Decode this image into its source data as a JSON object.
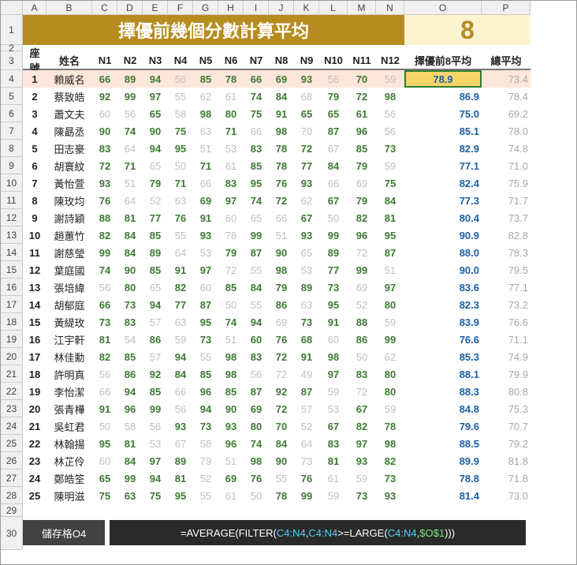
{
  "banner_title": "擇優前幾個分數計算平均",
  "banner_value": "8",
  "col_headers": [
    "A",
    "B",
    "C",
    "D",
    "E",
    "F",
    "G",
    "H",
    "I",
    "J",
    "K",
    "L",
    "M",
    "N",
    "O",
    "P"
  ],
  "row_numbers": [
    1,
    2,
    3,
    4,
    5,
    6,
    7,
    8,
    9,
    10,
    11,
    12,
    13,
    14,
    15,
    16,
    17,
    18,
    19,
    20,
    21,
    22,
    23,
    24,
    25,
    26,
    27,
    28,
    29,
    30
  ],
  "th": {
    "seat": "座號",
    "name": "姓名",
    "n": [
      "N1",
      "N2",
      "N3",
      "N4",
      "N5",
      "N6",
      "N7",
      "N8",
      "N9",
      "N10",
      "N11",
      "N12"
    ],
    "best8": "擇優前8平均",
    "avg": "總平均"
  },
  "rows": [
    {
      "seat": 1,
      "name": "賴威名",
      "s": [
        66,
        89,
        94,
        56,
        85,
        78,
        66,
        69,
        93,
        56,
        70,
        59
      ],
      "best8": "78.9",
      "avg": "73.4",
      "hl": true,
      "dark": [
        85,
        78,
        66,
        69,
        93,
        70,
        66,
        89,
        94
      ],
      "gray": [
        56,
        56,
        59
      ]
    },
    {
      "seat": 2,
      "name": "蔡致皓",
      "s": [
        92,
        99,
        97,
        55,
        62,
        61,
        74,
        84,
        68,
        79,
        72,
        98
      ],
      "best8": "86.9",
      "avg": "78.4",
      "dark": [
        92,
        99,
        97,
        74,
        84,
        79,
        72,
        98
      ],
      "gray": [
        55,
        62,
        61,
        68
      ]
    },
    {
      "seat": 3,
      "name": "蕭文夫",
      "s": [
        60,
        56,
        65,
        58,
        98,
        80,
        75,
        91,
        65,
        65,
        61,
        56
      ],
      "best8": "75.0",
      "avg": "69.2",
      "dark": [
        65,
        98,
        80,
        75,
        91,
        65,
        65,
        61
      ],
      "gray": [
        60,
        56,
        58,
        56
      ]
    },
    {
      "seat": 4,
      "name": "陳勗丞",
      "s": [
        90,
        74,
        90,
        75,
        63,
        71,
        66,
        98,
        70,
        87,
        96,
        56
      ],
      "best8": "85.1",
      "avg": "78.0",
      "dark": [
        90,
        74,
        90,
        75,
        71,
        98,
        87,
        96
      ],
      "gray": [
        63,
        66,
        70,
        56
      ]
    },
    {
      "seat": 5,
      "name": "田志豪",
      "s": [
        83,
        64,
        94,
        95,
        51,
        53,
        83,
        78,
        72,
        67,
        85,
        73
      ],
      "best8": "82.9",
      "avg": "74.8",
      "dark": [
        83,
        94,
        95,
        83,
        78,
        72,
        85,
        73
      ],
      "gray": [
        64,
        51,
        53,
        67
      ]
    },
    {
      "seat": 6,
      "name": "胡寰紋",
      "s": [
        72,
        71,
        65,
        50,
        71,
        61,
        85,
        78,
        77,
        84,
        79,
        59
      ],
      "best8": "77.1",
      "avg": "71.0",
      "dark": [
        72,
        71,
        71,
        85,
        78,
        77,
        84,
        79
      ],
      "gray": [
        65,
        50,
        61,
        59
      ]
    },
    {
      "seat": 7,
      "name": "黃怡萱",
      "s": [
        93,
        51,
        79,
        71,
        66,
        83,
        95,
        76,
        93,
        66,
        69,
        75
      ],
      "best8": "82.4",
      "avg": "75.9",
      "dark": [
        93,
        79,
        71,
        83,
        95,
        76,
        93,
        75
      ],
      "gray": [
        51,
        66,
        66,
        69
      ]
    },
    {
      "seat": 8,
      "name": "陳玫均",
      "s": [
        76,
        64,
        52,
        63,
        69,
        97,
        74,
        72,
        62,
        67,
        79,
        84
      ],
      "best8": "77.3",
      "avg": "71.7",
      "dark": [
        76,
        69,
        97,
        74,
        72,
        67,
        79,
        84
      ],
      "gray": [
        64,
        52,
        63,
        62
      ]
    },
    {
      "seat": 9,
      "name": "謝詩穎",
      "s": [
        88,
        81,
        77,
        76,
        91,
        60,
        65,
        66,
        67,
        50,
        82,
        81
      ],
      "best8": "80.4",
      "avg": "73.7",
      "dark": [
        88,
        81,
        77,
        76,
        91,
        67,
        82,
        81
      ],
      "gray": [
        60,
        65,
        66,
        50
      ]
    },
    {
      "seat": 10,
      "name": "趙蕙竹",
      "s": [
        82,
        84,
        85,
        55,
        93,
        78,
        99,
        51,
        93,
        99,
        96,
        95
      ],
      "best8": "90.9",
      "avg": "82.8",
      "dark": [
        82,
        84,
        85,
        93,
        99,
        93,
        99,
        96,
        95
      ],
      "gray": [
        55,
        78,
        51
      ]
    },
    {
      "seat": 11,
      "name": "謝慈瑩",
      "s": [
        99,
        84,
        89,
        64,
        53,
        79,
        87,
        90,
        65,
        89,
        72,
        87
      ],
      "best8": "88.0",
      "avg": "78.3",
      "dark": [
        99,
        84,
        89,
        79,
        87,
        90,
        89,
        87
      ],
      "gray": [
        64,
        53,
        65,
        72
      ]
    },
    {
      "seat": 12,
      "name": "葉庭國",
      "s": [
        74,
        90,
        85,
        91,
        97,
        72,
        55,
        98,
        53,
        77,
        99,
        51
      ],
      "best8": "90.0",
      "avg": "79.5",
      "dark": [
        90,
        85,
        91,
        97,
        98,
        77,
        99,
        74
      ],
      "gray": [
        72,
        55,
        53,
        51
      ]
    },
    {
      "seat": 13,
      "name": "張培緯",
      "s": [
        56,
        80,
        65,
        82,
        60,
        85,
        84,
        79,
        89,
        73,
        69,
        97
      ],
      "best8": "83.6",
      "avg": "77.1",
      "dark": [
        80,
        82,
        85,
        84,
        79,
        89,
        73,
        97
      ],
      "gray": [
        56,
        65,
        60,
        69
      ]
    },
    {
      "seat": 14,
      "name": "胡郁庭",
      "s": [
        66,
        73,
        94,
        77,
        87,
        50,
        55,
        86,
        63,
        95,
        52,
        80
      ],
      "best8": "82.3",
      "avg": "73.2",
      "dark": [
        73,
        94,
        77,
        87,
        86,
        95,
        80,
        66
      ],
      "gray": [
        50,
        55,
        63,
        52
      ]
    },
    {
      "seat": 15,
      "name": "黃緹玫",
      "s": [
        73,
        83,
        57,
        63,
        95,
        74,
        94,
        69,
        73,
        91,
        88,
        59
      ],
      "best8": "83.9",
      "avg": "76.6",
      "dark": [
        73,
        83,
        95,
        74,
        94,
        91,
        88,
        73
      ],
      "gray": [
        57,
        63,
        69,
        59
      ]
    },
    {
      "seat": 16,
      "name": "江宇軒",
      "s": [
        81,
        54,
        86,
        59,
        73,
        51,
        60,
        76,
        68,
        60,
        86,
        99
      ],
      "best8": "76.6",
      "avg": "71.1",
      "dark": [
        81,
        86,
        73,
        60,
        76,
        68,
        86,
        99
      ],
      "gray": [
        54,
        59,
        51,
        60
      ]
    },
    {
      "seat": 17,
      "name": "林佳勳",
      "s": [
        82,
        85,
        57,
        94,
        55,
        98,
        83,
        72,
        91,
        98,
        50,
        62
      ],
      "best8": "85.3",
      "avg": "74.9",
      "dark": [
        82,
        85,
        94,
        98,
        83,
        91,
        98,
        72
      ],
      "gray": [
        57,
        55,
        50,
        62
      ]
    },
    {
      "seat": 18,
      "name": "許明真",
      "s": [
        56,
        86,
        92,
        84,
        85,
        98,
        56,
        72,
        49,
        97,
        83,
        80
      ],
      "best8": "88.1",
      "avg": "79.9",
      "dark": [
        86,
        92,
        84,
        85,
        98,
        97,
        83,
        80
      ],
      "gray": [
        56,
        56,
        72,
        49
      ]
    },
    {
      "seat": 19,
      "name": "李怡潔",
      "s": [
        66,
        94,
        85,
        66,
        96,
        85,
        87,
        92,
        87,
        59,
        72,
        80
      ],
      "best8": "88.3",
      "avg": "80.8",
      "dark": [
        94,
        85,
        96,
        85,
        87,
        92,
        87,
        80
      ],
      "gray": [
        66,
        66,
        59,
        72
      ]
    },
    {
      "seat": 20,
      "name": "張青樺",
      "s": [
        91,
        96,
        99,
        56,
        94,
        90,
        69,
        72,
        57,
        53,
        67,
        59
      ],
      "best8": "84.8",
      "avg": "75.3",
      "dark": [
        91,
        96,
        99,
        94,
        90,
        69,
        72,
        67
      ],
      "gray": [
        56,
        57,
        53,
        59
      ]
    },
    {
      "seat": 21,
      "name": "吳虹君",
      "s": [
        50,
        58,
        56,
        93,
        73,
        93,
        80,
        70,
        52,
        67,
        82,
        78
      ],
      "best8": "79.6",
      "avg": "70.7",
      "dark": [
        93,
        73,
        93,
        80,
        70,
        67,
        82,
        78
      ],
      "gray": [
        50,
        58,
        56,
        52
      ]
    },
    {
      "seat": 22,
      "name": "林翰揚",
      "s": [
        95,
        81,
        53,
        67,
        58,
        96,
        74,
        84,
        64,
        83,
        97,
        98
      ],
      "best8": "88.5",
      "avg": "79.2",
      "dark": [
        95,
        81,
        96,
        74,
        84,
        83,
        97,
        98
      ],
      "gray": [
        53,
        67,
        58,
        64
      ]
    },
    {
      "seat": 23,
      "name": "林芷伶",
      "s": [
        60,
        84,
        97,
        89,
        79,
        51,
        98,
        90,
        73,
        81,
        93,
        82
      ],
      "best8": "89.9",
      "avg": "81.8",
      "dark": [
        84,
        97,
        89,
        98,
        90,
        81,
        93,
        82
      ],
      "gray": [
        60,
        79,
        51,
        73
      ]
    },
    {
      "seat": 24,
      "name": "鄭皓筌",
      "s": [
        65,
        99,
        94,
        81,
        52,
        69,
        76,
        55,
        76,
        61,
        59,
        73
      ],
      "best8": "78.8",
      "avg": "71.8",
      "dark": [
        99,
        94,
        81,
        69,
        76,
        76,
        73,
        65
      ],
      "gray": [
        52,
        55,
        61,
        59
      ]
    },
    {
      "seat": 25,
      "name": "陳明滋",
      "s": [
        75,
        63,
        75,
        95,
        55,
        61,
        50,
        78,
        99,
        59,
        73,
        93
      ],
      "best8": "81.4",
      "avg": "73.0",
      "dark": [
        75,
        75,
        95,
        78,
        99,
        73,
        93,
        63
      ],
      "gray": [
        55,
        61,
        50,
        59
      ]
    }
  ],
  "formula_cell_label": "儲存格O4",
  "formula_parts": {
    "p1": "=AVERAGE(FILTER(",
    "c1": "C4:N4",
    "comma1": ",",
    "c2": "C4:N4",
    "p2": ">=LARGE(",
    "c3": "C4:N4",
    "comma2": ",",
    "abs": "$O$1",
    "p3": ")))"
  },
  "chart_data": {
    "type": "table",
    "headers": [
      "座號",
      "姓名",
      "N1",
      "N2",
      "N3",
      "N4",
      "N5",
      "N6",
      "N7",
      "N8",
      "N9",
      "N10",
      "N11",
      "N12",
      "擇優前8平均",
      "總平均"
    ],
    "note": "rows array above contains full table data"
  }
}
